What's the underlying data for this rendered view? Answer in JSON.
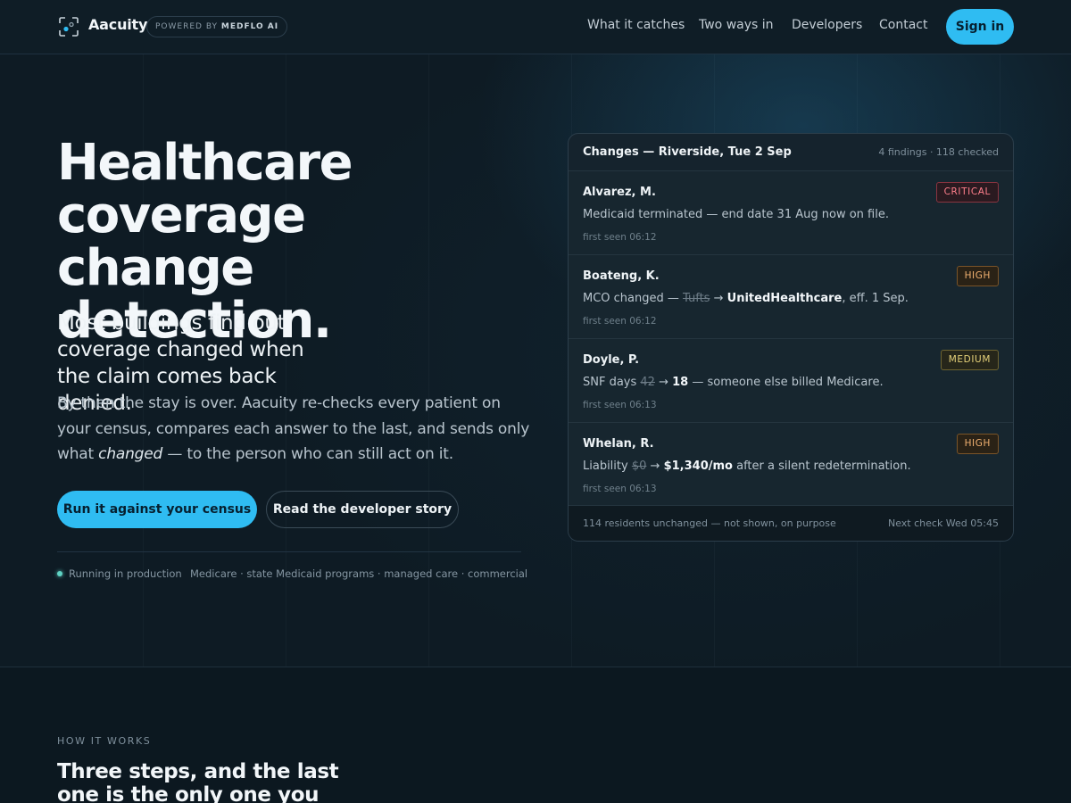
{
  "header": {
    "brand": "Aacuity",
    "powered_prefix": "POWERED BY",
    "powered_name": "MEDFLO AI",
    "nav": [
      "What it catches",
      "Two ways in",
      "Developers",
      "Contact"
    ],
    "signin_label": "Sign in"
  },
  "hero": {
    "title_lines": [
      "Healthcare",
      "coverage",
      "change detection."
    ],
    "lead": "Most buildings find out coverage changed when the claim comes back denied.",
    "body_before": "By then the stay is over. Aacuity re-checks every patient on your census, compares each answer to the last, and sends only what ",
    "body_em": "changed",
    "body_after": " — to the person who can still act on it.",
    "primary_cta": "Run it against your census",
    "secondary_cta": "Read the developer story",
    "status": "Running in production",
    "coverage": "Medicare · state Medicaid programs · managed care · commercial"
  },
  "panel": {
    "title": "Changes — Riverside, Tue 2 Sep",
    "meta": "4 findings · 118 checked",
    "findings": [
      {
        "name": "Alvarez, M.",
        "severity": "CRITICAL",
        "desc": {
          "pre": "Medicaid terminated — end date 31 Aug now on file.",
          "old": "",
          "arrow": "",
          "new": "",
          "post": ""
        },
        "time": "first seen 06:12"
      },
      {
        "name": "Boateng, K.",
        "severity": "HIGH",
        "desc": {
          "pre": "MCO changed — ",
          "old": "Tufts",
          "arrow": "→",
          "new": "UnitedHealthcare",
          "post": ", eff. 1 Sep."
        },
        "time": "first seen 06:12"
      },
      {
        "name": "Doyle, P.",
        "severity": "MEDIUM",
        "desc": {
          "pre": "SNF days ",
          "old": "42",
          "arrow": "→",
          "new": "18",
          "post": " — someone else billed Medicare."
        },
        "time": "first seen 06:13"
      },
      {
        "name": "Whelan, R.",
        "severity": "HIGH",
        "desc": {
          "pre": "Liability ",
          "old": "$0",
          "arrow": "→",
          "new": "$1,340/mo",
          "post": " after a silent redetermination."
        },
        "time": "first seen 06:13"
      }
    ],
    "footer_left": "114 residents unchanged — not shown, on purpose",
    "footer_right": "Next check Wed 05:45"
  },
  "how": {
    "eyebrow": "HOW IT WORKS",
    "title": "Three steps, and the last one is the only one you read."
  },
  "colors": {
    "accent": "#2fbcf2",
    "critical": "#e0566a",
    "high": "#e8a85c",
    "medium": "#e0c96a"
  }
}
